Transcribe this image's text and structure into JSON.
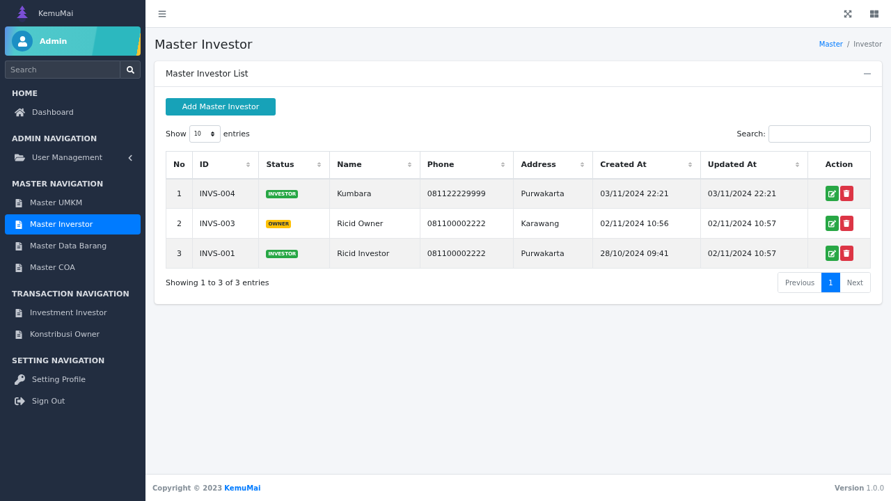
{
  "brand": {
    "name": "KemuMai"
  },
  "user": {
    "name": "Admin"
  },
  "sidebar_search": {
    "placeholder": "Search"
  },
  "sidebar": {
    "sections": [
      {
        "header": "HOME",
        "items": [
          {
            "label": "Dashboard",
            "kind": "home",
            "selected": false,
            "has_submenu": false
          }
        ]
      },
      {
        "header": "ADMIN NAVIGATION",
        "items": [
          {
            "label": "User Management",
            "kind": "folder",
            "selected": false,
            "has_submenu": true
          }
        ]
      },
      {
        "header": "MASTER NAVIGATION",
        "items": [
          {
            "label": "Master UMKM",
            "kind": "file",
            "selected": false,
            "has_submenu": false
          },
          {
            "label": "Master Inverstor",
            "kind": "file",
            "selected": true,
            "has_submenu": false
          },
          {
            "label": "Master Data Barang",
            "kind": "file",
            "selected": false,
            "has_submenu": false
          },
          {
            "label": "Master COA",
            "kind": "file",
            "selected": false,
            "has_submenu": false
          }
        ]
      },
      {
        "header": "TRANSACTION NAVIGATION",
        "items": [
          {
            "label": "Investment Investor",
            "kind": "file",
            "selected": false,
            "has_submenu": false
          },
          {
            "label": "Konstribusi Owner",
            "kind": "file",
            "selected": false,
            "has_submenu": false
          }
        ]
      },
      {
        "header": "SETTING NAVIGATION",
        "items": [
          {
            "label": "Setting Profile",
            "kind": "key",
            "selected": false,
            "has_submenu": false
          },
          {
            "label": "Sign Out",
            "kind": "signout",
            "selected": false,
            "has_submenu": false
          }
        ]
      }
    ]
  },
  "page": {
    "title": "Master Investor",
    "breadcrumb_separator": "/",
    "breadcrumb": [
      {
        "label": "Master",
        "link": true
      },
      {
        "label": "Investor",
        "link": false
      }
    ]
  },
  "card": {
    "title": "Master Investor List",
    "add_button": "Add Master Investor",
    "show_label": "Show",
    "page_length": "10",
    "entries_label": "entries",
    "search_label": "Search:",
    "columns": [
      {
        "label": "No",
        "sortable": false
      },
      {
        "label": "ID",
        "sortable": true
      },
      {
        "label": "Status",
        "sortable": true
      },
      {
        "label": "Name",
        "sortable": true
      },
      {
        "label": "Phone",
        "sortable": true
      },
      {
        "label": "Address",
        "sortable": true
      },
      {
        "label": "Created At",
        "sortable": true
      },
      {
        "label": "Updated At",
        "sortable": true
      },
      {
        "label": "Action",
        "sortable": false
      }
    ],
    "rows": [
      {
        "no": "1",
        "id": "INVS-004",
        "status": {
          "label": "INVESTOR",
          "kind": "investor"
        },
        "name": "Kumbara",
        "phone": "081122229999",
        "address": "Purwakarta",
        "created_at": "03/11/2024 22:21",
        "updated_at": "03/11/2024 22:21"
      },
      {
        "no": "2",
        "id": "INVS-003",
        "status": {
          "label": "OWNER",
          "kind": "owner"
        },
        "name": "Ricid Owner",
        "phone": "081100002222",
        "address": "Karawang",
        "created_at": "02/11/2024 10:56",
        "updated_at": "02/11/2024 10:57"
      },
      {
        "no": "3",
        "id": "INVS-001",
        "status": {
          "label": "INVESTOR",
          "kind": "investor"
        },
        "name": "Ricid Investor",
        "phone": "081100002222",
        "address": "Purwakarta",
        "created_at": "28/10/2024 09:41",
        "updated_at": "02/11/2024 10:57"
      }
    ],
    "info": "Showing 1 to 3 of 3 entries",
    "pagination": [
      {
        "label": "Previous",
        "selected": false
      },
      {
        "label": "1",
        "selected": true
      },
      {
        "label": "Next",
        "selected": false
      }
    ]
  },
  "footer": {
    "copyright": "Copyright © 2023",
    "brand": "KemuMai",
    "version_label": "Version",
    "version": "1.0.0"
  }
}
